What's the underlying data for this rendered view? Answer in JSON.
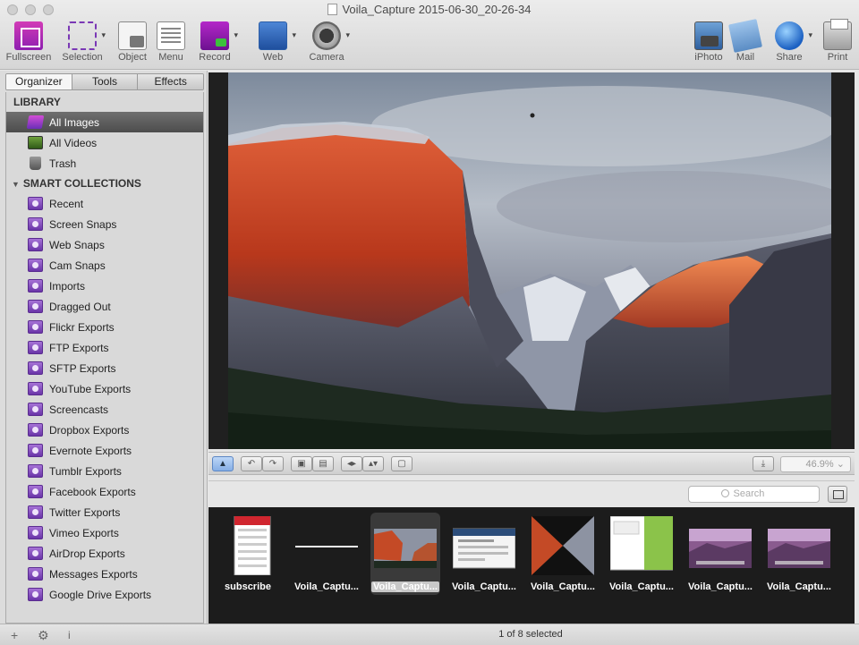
{
  "window": {
    "title": "Voila_Capture 2015-06-30_20-26-34"
  },
  "toolbar": {
    "left": [
      {
        "label": "Fullscreen",
        "icon": "fullscreen-icon",
        "caret": false
      },
      {
        "label": "Selection",
        "icon": "selection-icon",
        "caret": true
      },
      {
        "label": "Object",
        "icon": "object-icon",
        "caret": false
      },
      {
        "label": "Menu",
        "icon": "menu-icon",
        "caret": false
      },
      {
        "label": "Record",
        "icon": "record-icon",
        "caret": true
      },
      {
        "label": "Web",
        "icon": "web-icon",
        "caret": true
      },
      {
        "label": "Camera",
        "icon": "camera-icon",
        "caret": true
      }
    ],
    "right": [
      {
        "label": "iPhoto",
        "icon": "iphoto-icon",
        "caret": false
      },
      {
        "label": "Mail",
        "icon": "mail-icon",
        "caret": false
      },
      {
        "label": "Share",
        "icon": "share-icon",
        "caret": true
      },
      {
        "label": "Print",
        "icon": "printer-icon",
        "caret": false
      }
    ]
  },
  "sidebar": {
    "tabs": [
      {
        "label": "Organizer",
        "active": true
      },
      {
        "label": "Tools",
        "active": false
      },
      {
        "label": "Effects",
        "active": false
      }
    ],
    "library_heading": "LIBRARY",
    "library": [
      {
        "label": "All Images",
        "icon": "images-icon",
        "selected": true
      },
      {
        "label": "All Videos",
        "icon": "videos-icon",
        "selected": false
      },
      {
        "label": "Trash",
        "icon": "trash-icon",
        "selected": false
      }
    ],
    "smart_heading": "SMART COLLECTIONS",
    "smart": [
      "Recent",
      "Screen Snaps",
      "Web Snaps",
      "Cam Snaps",
      "Imports",
      "Dragged Out",
      "Flickr Exports",
      "FTP Exports",
      "SFTP Exports",
      "YouTube Exports",
      "Screencasts",
      "Dropbox Exports",
      "Evernote Exports",
      "Tumblr Exports",
      "Facebook Exports",
      "Twitter Exports",
      "Vimeo Exports",
      "AirDrop Exports",
      "Messages Exports",
      "Google Drive Exports"
    ]
  },
  "viewer": {
    "zoom": "46.9%"
  },
  "search": {
    "placeholder": "Search"
  },
  "thumbnails": [
    {
      "caption": "subscribe",
      "selected": false,
      "kind": "phone"
    },
    {
      "caption": "Voila_Captu...",
      "selected": false,
      "kind": "line"
    },
    {
      "caption": "Voila_Captu...",
      "selected": true,
      "kind": "mountain"
    },
    {
      "caption": "Voila_Captu...",
      "selected": false,
      "kind": "web"
    },
    {
      "caption": "Voila_Captu...",
      "selected": false,
      "kind": "bowtie"
    },
    {
      "caption": "Voila_Captu...",
      "selected": false,
      "kind": "page"
    },
    {
      "caption": "Voila_Captu...",
      "selected": false,
      "kind": "desktop"
    },
    {
      "caption": "Voila_Captu...",
      "selected": false,
      "kind": "desktop"
    }
  ],
  "status": {
    "count": "1 of 8 selected"
  },
  "colors": {
    "accent_purple": "#7a38b5",
    "selection_gray": "#5a5a5a"
  }
}
